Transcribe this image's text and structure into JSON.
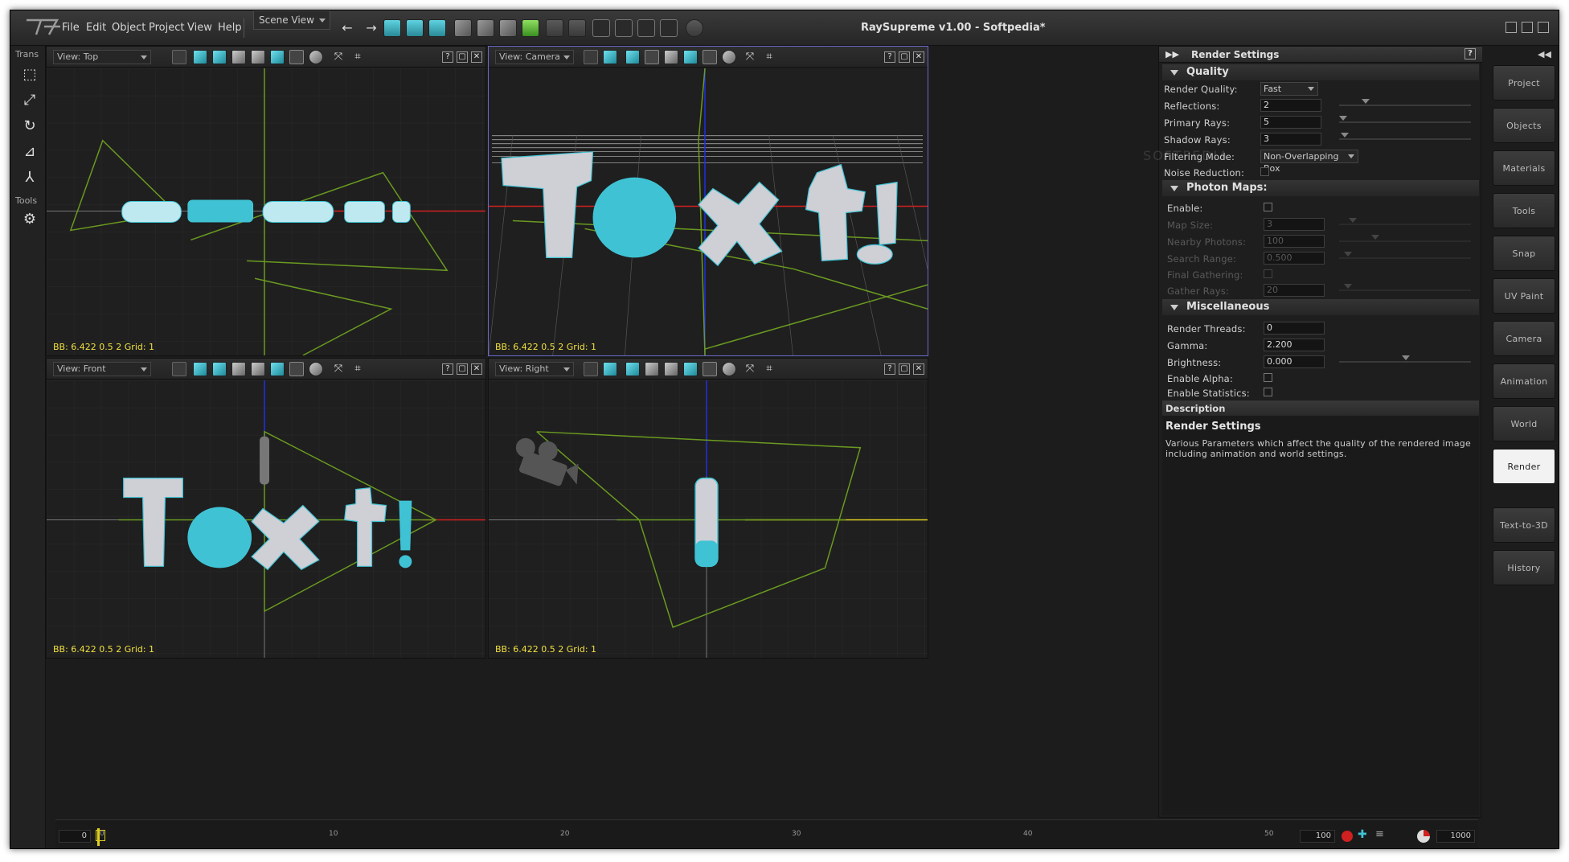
{
  "menu": {
    "file": "File",
    "edit": "Edit",
    "object": "Object",
    "project": "Project",
    "view": "View",
    "help": "Help"
  },
  "toolbar": {
    "scene_combo": "Scene View"
  },
  "window_title": "RaySupreme v1.00 - Softpedia*",
  "left_tools": {
    "trans": "Trans",
    "tools": "Tools"
  },
  "viewports": {
    "top": {
      "view": "View: Top",
      "bb": "BB: 6.422  0.5  2    Grid: 1"
    },
    "camera": {
      "view": "View: Camera",
      "bb": "BB: 6.422  0.5  2    Grid: 1"
    },
    "front": {
      "view": "View: Front",
      "bb": "BB: 6.422  0.5  2    Grid: 1"
    },
    "right": {
      "view": "View: Right",
      "bb": "BB: 6.422  0.5  2    Grid: 1"
    }
  },
  "render_panel": {
    "title": "Render Settings",
    "quality": {
      "header": "Quality",
      "render_quality_label": "Render Quality:",
      "render_quality": "Fast",
      "reflections_label": "Reflections:",
      "reflections": "2",
      "primary_rays_label": "Primary Rays:",
      "primary_rays": "5",
      "shadow_rays_label": "Shadow Rays:",
      "shadow_rays": "3",
      "filtering_label": "Filtering Mode:",
      "filtering": "Non-Overlapping Box",
      "noise_label": "Noise Reduction:"
    },
    "photon": {
      "header": "Photon Maps:",
      "enable_label": "Enable:",
      "map_size_label": "Map Size:",
      "map_size": "3",
      "nearby_label": "Nearby Photons:",
      "nearby": "100",
      "search_label": "Search Range:",
      "search": "0.500",
      "final_label": "Final Gathering:",
      "gather_label": "Gather Rays:",
      "gather": "20"
    },
    "misc": {
      "header": "Miscellaneous",
      "threads_label": "Render Threads:",
      "threads": "0",
      "gamma_label": "Gamma:",
      "gamma": "2.200",
      "brightness_label": "Brightness:",
      "brightness": "0.000",
      "alpha_label": "Enable Alpha:",
      "stats_label": "Enable Statistics:"
    },
    "description": {
      "header": "Description",
      "title": "Render Settings",
      "text": "Various Parameters which affect the quality of the rendered image including animation and world settings."
    },
    "watermark": "SOFTPEDIA"
  },
  "side_tabs": {
    "project": "Project",
    "objects": "Objects",
    "materials": "Materials",
    "tools": "Tools",
    "snap": "Snap",
    "uvpaint": "UV Paint",
    "camera": "Camera",
    "animation": "Animation",
    "world": "World",
    "render": "Render",
    "text3d": "Text-to-3D",
    "history": "History"
  },
  "timeline": {
    "start": "0",
    "end": "100",
    "frames": "1000",
    "t0": "0",
    "t10": "10",
    "t20": "20",
    "t30": "30",
    "t40": "40",
    "t50": "50"
  },
  "colors": {
    "accent_cyan": "#3fc3d4",
    "grid_green": "#6a9a20",
    "axis_red": "#d02020",
    "axis_blue": "#2030e0",
    "active_border": "#6a68c8",
    "bb_text": "#f0e040"
  }
}
